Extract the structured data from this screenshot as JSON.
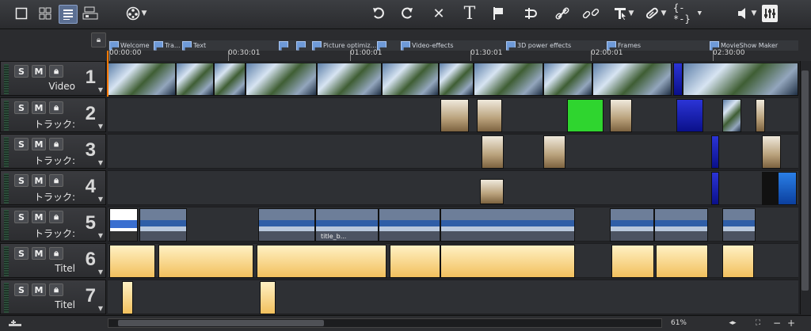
{
  "toolbar": {
    "left_icons": [
      "single-view-icon",
      "multi-view-icon",
      "timeline-view-icon",
      "storyboard-icon",
      "reel-icon"
    ],
    "right_icons": [
      "undo-icon",
      "redo-icon",
      "delete-icon",
      "title-icon",
      "marker-icon",
      "split-icon",
      "link-icon",
      "unlink-icon",
      "mouse-mode-icon",
      "razor-icon",
      "range-icon",
      "volume-icon",
      "mixer-icon"
    ],
    "title_glyph": "T",
    "range_glyph": "{-*-}"
  },
  "markers": [
    {
      "label": "Welcome"
    },
    {
      "label": "Tra..."
    },
    {
      "label": "Text"
    },
    {
      "label": ""
    },
    {
      "label": ""
    },
    {
      "label": "Picture optimiz..."
    },
    {
      "label": ""
    },
    {
      "label": "Video-effects"
    },
    {
      "label": "3D power effects"
    },
    {
      "label": "Frames"
    },
    {
      "label": "MovieShow Maker"
    }
  ],
  "ruler": {
    "labels": [
      "00:00:00",
      "00:30:01",
      "01:00:01",
      "01:30:01",
      "02:00:01",
      "02:30:00"
    ]
  },
  "tracks": [
    {
      "num": "1",
      "name": "Video",
      "s": "S",
      "m": "M"
    },
    {
      "num": "2",
      "name": "トラック:",
      "s": "S",
      "m": "M"
    },
    {
      "num": "3",
      "name": "トラック:",
      "s": "S",
      "m": "M"
    },
    {
      "num": "4",
      "name": "トラック:",
      "s": "S",
      "m": "M"
    },
    {
      "num": "5",
      "name": "トラック:",
      "s": "S",
      "m": "M"
    },
    {
      "num": "6",
      "name": "Titel",
      "s": "S",
      "m": "M"
    },
    {
      "num": "7",
      "name": "Titel",
      "s": "S",
      "m": "M"
    }
  ],
  "clip_label": "title_b...",
  "bottom": {
    "zoom": "61%"
  }
}
